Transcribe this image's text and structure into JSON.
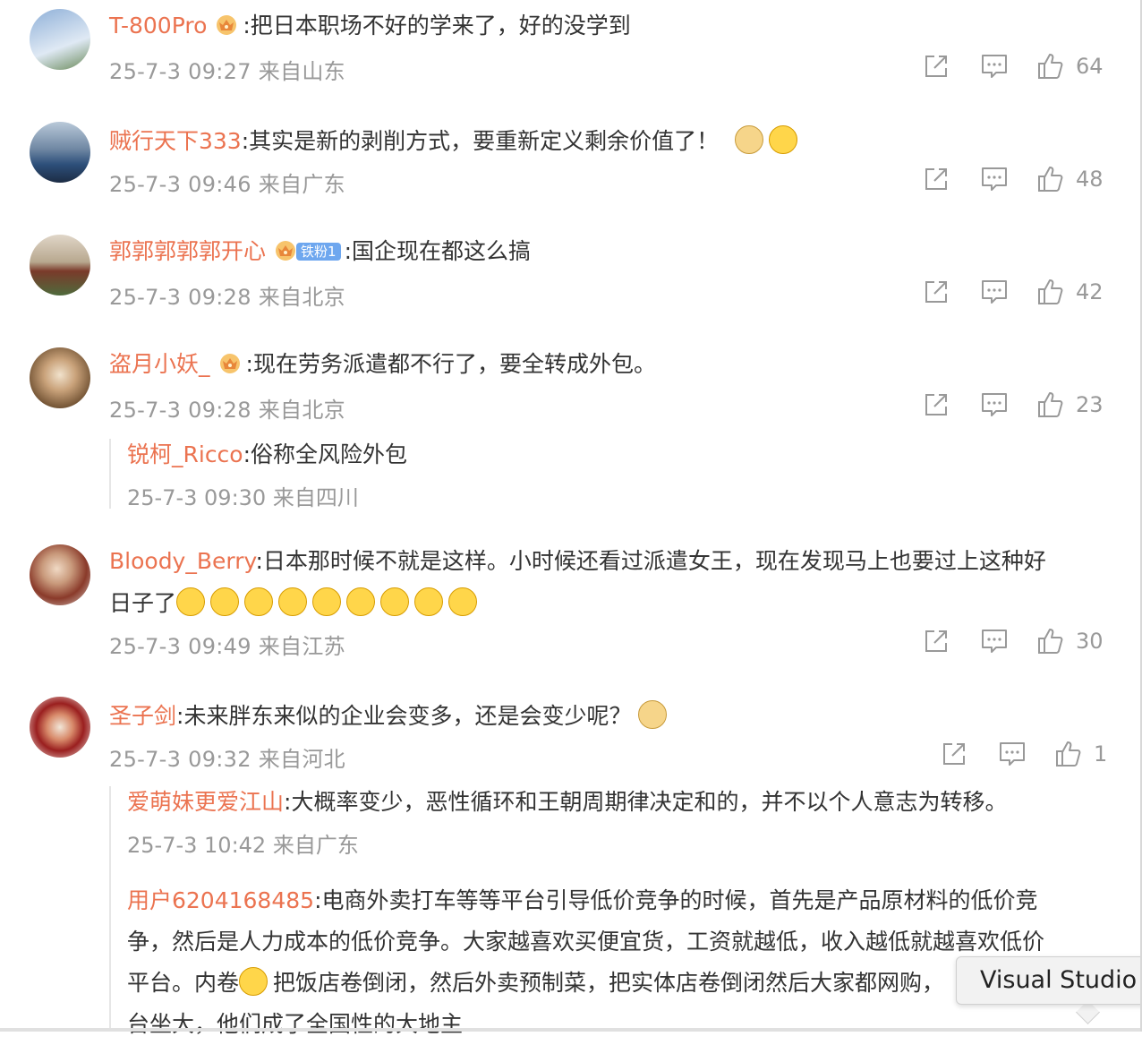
{
  "comments": [
    {
      "user": "T-800Pro",
      "text": ":把日本职场不好的学来了，好的没学到",
      "meta": "25-7-3 09:27 来自山东",
      "likes": "64",
      "avatar_colors": [
        "#8fb0d8",
        "#dfe9f4"
      ]
    },
    {
      "user": "贼行天下333",
      "text": ":其实是新的剥削方式，要重新定义剩余价值了！",
      "meta": "25-7-3 09:46 来自广东",
      "likes": "48",
      "avatar_colors": [
        "#2d4f7a",
        "#b9c9d9"
      ]
    },
    {
      "user": "郭郭郭郭郭开心",
      "badge": "铁粉1",
      "text": ":国企现在都这么搞",
      "meta": "25-7-3 09:28 来自北京",
      "likes": "42",
      "avatar_colors": [
        "#9a8c7c",
        "#e0d6c8"
      ]
    },
    {
      "user": "盗月小妖_",
      "text": ":现在劳务派遣都不行了，要全转成外包。",
      "meta": "25-7-3 09:28 来自北京",
      "likes": "23",
      "avatar_colors": [
        "#7a5a3a",
        "#e9d9c6"
      ],
      "replies": [
        {
          "user": "锐柯_Ricco",
          "text": ":俗称全风险外包",
          "meta": "25-7-3 09:30 来自四川"
        }
      ]
    },
    {
      "user": "Bloody_Berry",
      "text": ":日本那时候不就是这样。小时候还看过派遣女王，现在发现马上也要过上这种好",
      "text2": "日子了",
      "meta": "25-7-3 09:49 来自江苏",
      "likes": "30",
      "avatar_colors": [
        "#6b2a1f",
        "#d9b59c"
      ]
    },
    {
      "user": "圣子剑",
      "text": ":未来胖东来似的企业会变多，还是会变少呢？",
      "meta": "25-7-3 09:32 来自河北",
      "likes": "1",
      "avatar_colors": [
        "#9a1f1f",
        "#f1e6d8"
      ],
      "replies": [
        {
          "user": "爱萌妹更爱江山",
          "text": ":大概率变少，恶性循环和王朝周期律决定和的，并不以个人意志为转移。",
          "meta": "25-7-3 10:42 来自广东"
        },
        {
          "user": "用户6204168485",
          "text": ":电商外卖打车等等平台引导低价竞争的时候，首先是产品原材料的低价竞",
          "line2": "争，然后是人力成本的低价竞争。大家越喜欢买便宜货，工资就越低，收入越低就越喜欢低价",
          "line3a": "平台。内卷",
          "line3b": "把饭店卷倒闭，然后外卖预制菜，把实体店卷倒闭然后大家都网购，",
          "line4": "台坐大，他们成了全国性的大地主"
        }
      ]
    }
  ],
  "tooltip": {
    "text": "Visual Studio C"
  },
  "colors": {
    "username": "#eb7350",
    "meta": "#999999",
    "text": "#333333",
    "badge": "#6ea7ef"
  },
  "icons": {
    "share": "share-icon",
    "comment": "comment-icon",
    "like": "thumbs-up-icon",
    "crown": "crown-icon"
  }
}
